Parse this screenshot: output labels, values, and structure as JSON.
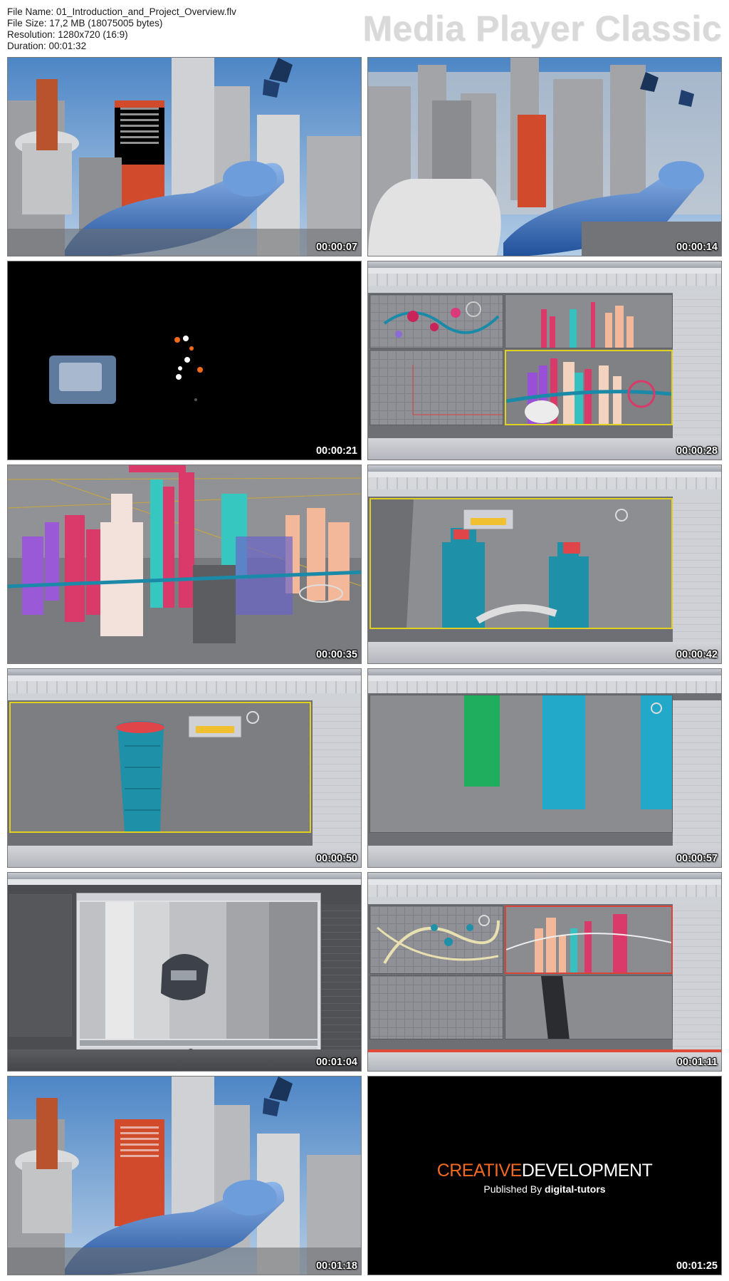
{
  "header": {
    "file_name": "File Name: 01_Introduction_and_Project_Overview.flv",
    "file_size": "File Size: 17,2 MB (18075005 bytes)",
    "resolution": "Resolution: 1280x720 (16:9)",
    "duration": "Duration: 00:01:32",
    "brand": "Media Player Classic"
  },
  "thumbnails": [
    {
      "timestamp": "00:00:07",
      "scene": "city-render"
    },
    {
      "timestamp": "00:00:14",
      "scene": "city-render-blocky"
    },
    {
      "timestamp": "00:00:21",
      "scene": "black-transition"
    },
    {
      "timestamp": "00:00:28",
      "scene": "3dsmax-four-viewports"
    },
    {
      "timestamp": "00:00:35",
      "scene": "wireframe-city"
    },
    {
      "timestamp": "00:00:42",
      "scene": "3dsmax-towers"
    },
    {
      "timestamp": "00:00:50",
      "scene": "3dsmax-tower-single"
    },
    {
      "timestamp": "00:00:57",
      "scene": "3dsmax-front-view"
    },
    {
      "timestamp": "00:01:04",
      "scene": "3dsmax-render-window"
    },
    {
      "timestamp": "00:01:11",
      "scene": "3dsmax-four-viewports-b"
    },
    {
      "timestamp": "00:01:18",
      "scene": "city-render"
    },
    {
      "timestamp": "00:01:25",
      "scene": "credits"
    }
  ],
  "credits": {
    "creative": "CREATIVE",
    "development": "DEVELOPMENT",
    "published_by": "Published By",
    "company": "digital-tutors"
  },
  "colors": {
    "ship_blue": "#3f74c4",
    "selection_yellow": "#e0d020",
    "tower_teal": "#1e90a8",
    "brand_orange": "#f26a21"
  }
}
